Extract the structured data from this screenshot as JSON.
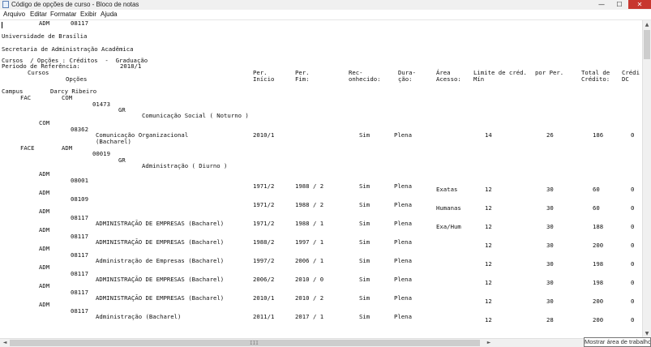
{
  "window": {
    "title": "Código de opções de curso - Bloco de notas",
    "controls": {
      "minimize": "—",
      "maximize": "☐",
      "close": "✕"
    }
  },
  "menu": [
    "Arquivo",
    "Editar",
    "Formatar",
    "Exibir",
    "Ajuda"
  ],
  "doc": {
    "university": "Universidade de Brasília",
    "secretariat": "Secretaria de Administração Acadêmica",
    "report_title": "Cursos  / Opções : Créditos  -  Graduação",
    "period_label": "Período de Referência:",
    "period_value": "2018/1",
    "headers": {
      "cursos": "Cursos",
      "opcoes": "Opções",
      "campus": "Campus",
      "per_inicio_1": "Per.",
      "per_inicio_2": "Início",
      "per_fim_1": "Per.",
      "per_fim_2": "Fim:",
      "reconhecido_1": "Rec-",
      "reconhecido_2": "onhecido:",
      "duracao_1": "Dura-",
      "duracao_2": "ção:",
      "area_1": "Área",
      "area_2": "Acesso:",
      "limite_1": "Limite de créd.",
      "limite_2": "Mín",
      "por_per": "por Per.",
      "total_1": "Total de",
      "total_2": "Crédito:",
      "credi_1": "Crédi",
      "credi_2": "DC"
    },
    "campus_name": "Darcy Ribeiro",
    "fac1": {
      "unit": "FAC",
      "code": "COM",
      "course_code": "01473",
      "grade": "GR",
      "course_name": "Comunicação Social ( Noturno )"
    },
    "com_row": {
      "code": "COM",
      "opt": "08362",
      "name": "Comunicação Organizacional",
      "name2": "(Bacharel)",
      "start": "2010/1",
      "end": "",
      "rec": "Sim",
      "dur": "Plena",
      "area": "",
      "min": "14",
      "per": "26",
      "total": "186",
      "dc": "0"
    },
    "fac2": {
      "unit": "FACE",
      "code": "ADM",
      "course_code": "00019",
      "grade": "GR",
      "course_name": "Administração ( Diurno )"
    },
    "rows": [
      {
        "dept": "ADM",
        "opt": "08001",
        "name": "",
        "start": "1971/2",
        "end": "1988 / 2",
        "rec": "Sim",
        "dur": "Plena",
        "area": "Exatas",
        "min": "12",
        "per": "30",
        "total": "60",
        "dc": "0"
      },
      {
        "dept": "ADM",
        "opt": "08109",
        "name": "",
        "start": "1971/2",
        "end": "1988 / 2",
        "rec": "Sim",
        "dur": "Plena",
        "area": "Humanas",
        "min": "12",
        "per": "30",
        "total": "60",
        "dc": "0"
      },
      {
        "dept": "ADM",
        "opt": "08117",
        "name": "ADMINISTRAÇÃO DE EMPRESAS (Bacharel)",
        "start": "1971/2",
        "end": "1988 / 1",
        "rec": "Sim",
        "dur": "Plena",
        "area": "Exa/Hum",
        "min": "12",
        "per": "30",
        "total": "188",
        "dc": "0"
      },
      {
        "dept": "ADM",
        "opt": "08117",
        "name": "ADMINISTRAÇÃO DE EMPRESAS (Bacharel)",
        "start": "1988/2",
        "end": "1997 / 1",
        "rec": "Sim",
        "dur": "Plena",
        "area": "",
        "min": "12",
        "per": "30",
        "total": "200",
        "dc": "0"
      },
      {
        "dept": "ADM",
        "opt": "08117",
        "name": "Administração de Empresas (Bacharel)",
        "start": "1997/2",
        "end": "2006 / 1",
        "rec": "Sim",
        "dur": "Plena",
        "area": "",
        "min": "12",
        "per": "30",
        "total": "198",
        "dc": "0"
      },
      {
        "dept": "ADM",
        "opt": "08117",
        "name": "ADMINISTRAÇÃO DE EMPRESAS (Bacharel)",
        "start": "2006/2",
        "end": "2010 / 0",
        "rec": "Sim",
        "dur": "Plena",
        "area": "",
        "min": "12",
        "per": "30",
        "total": "198",
        "dc": "0"
      },
      {
        "dept": "ADM",
        "opt": "08117",
        "name": "ADMINISTRAÇÃO DE EMPRESAS (Bacharel)",
        "start": "2010/1",
        "end": "2010 / 2",
        "rec": "Sim",
        "dur": "Plena",
        "area": "",
        "min": "12",
        "per": "30",
        "total": "200",
        "dc": "0"
      },
      {
        "dept": "ADM",
        "opt": "08117",
        "name": "Administração (Bacharel)",
        "start": "2011/1",
        "end": "2017 / 1",
        "rec": "Sim",
        "dur": "Plena",
        "area": "",
        "min": "12",
        "per": "28",
        "total": "200",
        "dc": "0"
      },
      {
        "dept": "ADM",
        "opt": "08117"
      }
    ]
  },
  "scroll": {
    "up": "▲",
    "down": "▼",
    "left": "◄",
    "right": "►",
    "grip": "III"
  },
  "tooltip": "Mostrar área de trabalho"
}
